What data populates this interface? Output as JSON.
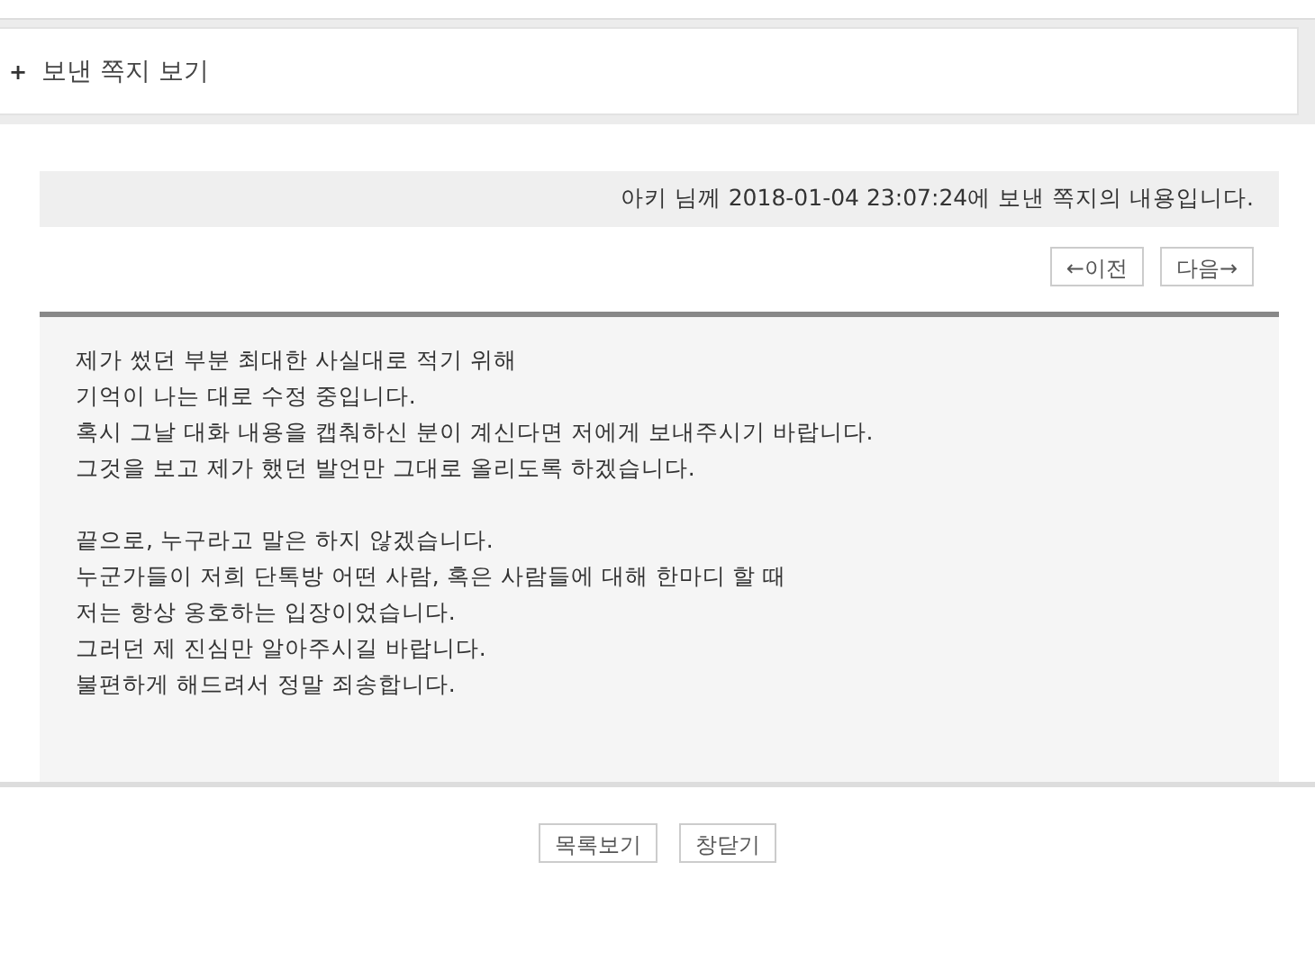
{
  "header": {
    "bullet": "+",
    "title": "보낸 쪽지 보기"
  },
  "info": "아키 님께 2018-01-04 23:07:24에 보낸 쪽지의 내용입니다.",
  "nav_buttons": [
    "←이전",
    "다음→"
  ],
  "message": {
    "paragraphs": [
      [
        "제가 썼던 부분 최대한 사실대로 적기 위해",
        "기억이 나는 대로 수정 중입니다.",
        "혹시 그날 대화 내용을 캡춰하신 분이 계신다면 저에게 보내주시기 바랍니다.",
        "그것을 보고 제가 했던 발언만 그대로 올리도록 하겠습니다."
      ],
      [
        "끝으로, 누구라고 말은 하지 않겠습니다.",
        "누군가들이 저희 단톡방 어떤 사람, 혹은 사람들에 대해 한마디 할 때",
        "저는 항상 옹호하는 입장이었습니다.",
        "그러던 제 진심만 알아주시길 바랍니다.",
        "불편하게 해드려서 정말 죄송합니다."
      ]
    ]
  },
  "bottom_buttons": [
    "목록보기",
    "창닫기"
  ]
}
